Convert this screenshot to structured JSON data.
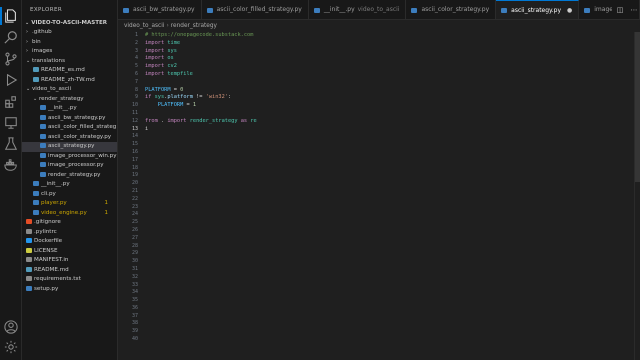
{
  "activity_bar": {
    "icons": [
      "files-icon",
      "search-icon",
      "source-control-icon",
      "run-debug-icon",
      "extensions-icon",
      "remote-explorer-icon",
      "testing-icon",
      "docker-icon",
      "account-icon",
      "settings-gear-icon"
    ]
  },
  "sidebar": {
    "title": "EXPLORER",
    "root": "VIDEO-TO-ASCII-MASTER",
    "items": [
      {
        "label": ".github",
        "type": "folder",
        "open": false,
        "depth": 1
      },
      {
        "label": "bin",
        "type": "folder",
        "open": false,
        "depth": 1
      },
      {
        "label": "images",
        "type": "folder",
        "open": false,
        "depth": 1
      },
      {
        "label": "translations",
        "type": "folder",
        "open": true,
        "depth": 1
      },
      {
        "label": "README_es.md",
        "type": "md",
        "depth": 2
      },
      {
        "label": "README_zh-TW.md",
        "type": "md",
        "depth": 2
      },
      {
        "label": "video_to_ascii",
        "type": "folder",
        "open": true,
        "depth": 1
      },
      {
        "label": "render_strategy",
        "type": "folder",
        "open": true,
        "depth": 2
      },
      {
        "label": "__init__.py",
        "type": "py",
        "depth": 3
      },
      {
        "label": "ascii_bw_strategy.py",
        "type": "py",
        "depth": 3
      },
      {
        "label": "ascii_color_filled_strateg...",
        "type": "py",
        "depth": 3
      },
      {
        "label": "ascii_color_strategy.py",
        "type": "py",
        "depth": 3
      },
      {
        "label": "ascii_strategy.py",
        "type": "py",
        "depth": 3,
        "selected": true
      },
      {
        "label": "image_processor_win.py",
        "type": "py",
        "depth": 3
      },
      {
        "label": "image_processor.py",
        "type": "py",
        "depth": 3
      },
      {
        "label": "render_strategy.py",
        "type": "py",
        "depth": 3
      },
      {
        "label": "__init__.py",
        "type": "py",
        "depth": 2
      },
      {
        "label": "cli.py",
        "type": "py",
        "depth": 2
      },
      {
        "label": "player.py",
        "type": "py",
        "depth": 2,
        "warn": true,
        "badge": "1"
      },
      {
        "label": "video_engine.py",
        "type": "py",
        "depth": 2,
        "warn": true,
        "badge": "1"
      },
      {
        "label": ".gitignore",
        "type": "git",
        "depth": 1
      },
      {
        "label": ".pylintrc",
        "type": "cfg",
        "depth": 1
      },
      {
        "label": "Dockerfile",
        "type": "docker",
        "depth": 1
      },
      {
        "label": "LICENSE",
        "type": "license",
        "depth": 1
      },
      {
        "label": "MANIFEST.in",
        "type": "cfg",
        "depth": 1
      },
      {
        "label": "README.md",
        "type": "md",
        "depth": 1
      },
      {
        "label": "requirements.txt",
        "type": "txt",
        "depth": 1
      },
      {
        "label": "setup.py",
        "type": "py",
        "depth": 1
      }
    ]
  },
  "tabs": [
    {
      "label": "ascii_bw_strategy.py",
      "active": false
    },
    {
      "label": "ascii_color_filled_strategy.py",
      "active": false
    },
    {
      "label": "__init__.py",
      "sub": "video_to_ascii",
      "active": false
    },
    {
      "label": "ascii_color_strategy.py",
      "active": false
    },
    {
      "label": "ascii_strategy.py",
      "active": true,
      "close": "●"
    },
    {
      "label": "image_proce",
      "active": false
    }
  ],
  "tab_actions": [
    "split-editor-icon",
    "more-actions-icon"
  ],
  "breadcrumb": [
    "video_to_ascii",
    "render_strategy"
  ],
  "editor": {
    "line_count": 40,
    "current_line": 13,
    "lines": [
      [
        {
          "t": "# https://onepagecode.substack.com",
          "c": "cm"
        }
      ],
      [
        {
          "t": "import",
          "c": "kw"
        },
        {
          "t": " "
        },
        {
          "t": "time",
          "c": "mod"
        }
      ],
      [
        {
          "t": "import",
          "c": "kw"
        },
        {
          "t": " "
        },
        {
          "t": "sys",
          "c": "mod"
        }
      ],
      [
        {
          "t": "import",
          "c": "kw"
        },
        {
          "t": " "
        },
        {
          "t": "os",
          "c": "mod"
        }
      ],
      [
        {
          "t": "import",
          "c": "kw"
        },
        {
          "t": " "
        },
        {
          "t": "cv2",
          "c": "mod"
        }
      ],
      [
        {
          "t": "import",
          "c": "kw"
        },
        {
          "t": " "
        },
        {
          "t": "tempfile",
          "c": "mod"
        }
      ],
      [],
      [
        {
          "t": "PLATFORM",
          "c": "cst"
        },
        {
          "t": " = ",
          "c": "op"
        },
        {
          "t": "0",
          "c": "num"
        }
      ],
      [
        {
          "t": "if",
          "c": "kw"
        },
        {
          "t": " "
        },
        {
          "t": "sys",
          "c": "mod"
        },
        {
          "t": "."
        },
        {
          "t": "platform",
          "c": "var"
        },
        {
          "t": " != ",
          "c": "op"
        },
        {
          "t": "'win32'",
          "c": "str"
        },
        {
          "t": ":"
        }
      ],
      [
        {
          "t": "    "
        },
        {
          "t": "PLATFORM",
          "c": "cst"
        },
        {
          "t": " = ",
          "c": "op"
        },
        {
          "t": "1",
          "c": "num"
        }
      ],
      [],
      [
        {
          "t": "from",
          "c": "kw"
        },
        {
          "t": " . "
        },
        {
          "t": "import",
          "c": "kw"
        },
        {
          "t": " "
        },
        {
          "t": "render_strategy",
          "c": "mod"
        },
        {
          "t": " "
        },
        {
          "t": "as",
          "c": "kw"
        },
        {
          "t": " "
        },
        {
          "t": "re",
          "c": "mod"
        }
      ],
      [
        {
          "t": "i"
        }
      ]
    ]
  }
}
